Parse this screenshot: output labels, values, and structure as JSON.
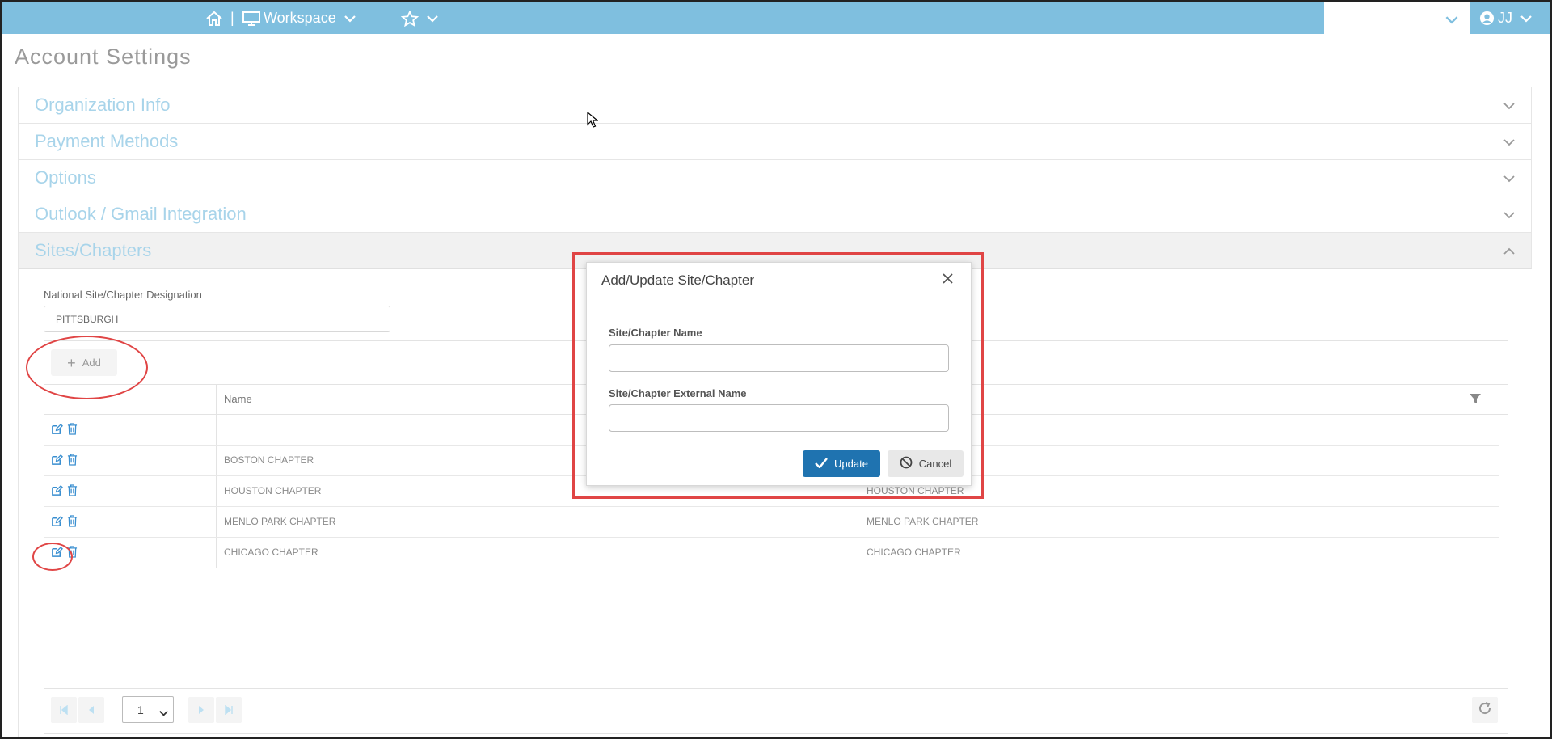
{
  "topbar": {
    "workspace_label": "Workspace",
    "user_initials": "JJ",
    "color": "#7fbfdf"
  },
  "page": {
    "title": "Account Settings"
  },
  "accordion": {
    "items": [
      {
        "label": "Organization Info"
      },
      {
        "label": "Payment Methods"
      },
      {
        "label": "Options"
      },
      {
        "label": "Outlook / Gmail Integration"
      },
      {
        "label": "Sites/Chapters"
      }
    ],
    "label_color": "#a8d4ea"
  },
  "sites": {
    "national_label": "National Site/Chapter Designation",
    "national_value": "PITTSBURGH",
    "add_label": "Add",
    "columns": {
      "name": "Name"
    },
    "rows": [
      {
        "name": "",
        "external": ""
      },
      {
        "name": "BOSTON CHAPTER",
        "external": ""
      },
      {
        "name": "HOUSTON CHAPTER",
        "external": "HOUSTON CHAPTER"
      },
      {
        "name": "MENLO PARK CHAPTER",
        "external": "MENLO PARK CHAPTER"
      },
      {
        "name": "CHICAGO CHAPTER",
        "external": "CHICAGO CHAPTER"
      }
    ],
    "pager": {
      "page": "1"
    }
  },
  "modal": {
    "title": "Add/Update Site/Chapter",
    "name_label": "Site/Chapter Name",
    "name_value": "",
    "external_label": "Site/Chapter External Name",
    "external_value": "",
    "update_label": "Update",
    "cancel_label": "Cancel",
    "update_color": "#1f73b0"
  },
  "annotation_color": "#e04545"
}
